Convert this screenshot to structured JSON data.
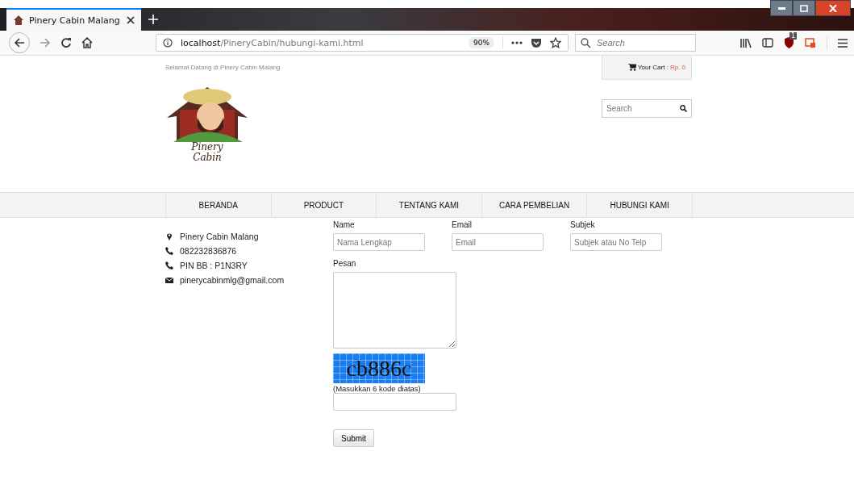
{
  "browser": {
    "tab_title": "Pinery Cabin Malang",
    "url_host": "localhost",
    "url_path": "/PineryCabin/hubungi-kami.html",
    "zoom": "90%",
    "search_placeholder": "Search",
    "badge": "1"
  },
  "header": {
    "welcome": "Selamat Datang di Pinery Cabin Malang",
    "cart_label": "Your Cart :",
    "cart_value": "Rp. 0",
    "search_placeholder": "Search",
    "logo_text": [
      "Pinery",
      "Cabin"
    ]
  },
  "nav": [
    {
      "label": "BERANDA",
      "selected": false
    },
    {
      "label": "PRODUCT",
      "selected": false
    },
    {
      "label": "TENTANG KAMI",
      "selected": false
    },
    {
      "label": "CARA PEMBELIAN",
      "selected": false
    },
    {
      "label": "HUBUNGI KAMI",
      "selected": false
    }
  ],
  "contact": [
    {
      "kind": "location",
      "text": "Pinery Cabin Malang"
    },
    {
      "kind": "phone",
      "text": "082232836876"
    },
    {
      "kind": "phone",
      "text": "PIN BB : P1N3RY"
    },
    {
      "kind": "email",
      "text": "pinerycabinmlg@gmail.com"
    }
  ],
  "form": {
    "fields": [
      {
        "label": "Name",
        "placeholder": "Nama Lengkap"
      },
      {
        "label": "Email",
        "placeholder": "Email"
      },
      {
        "label": "Subjek",
        "placeholder": "Subjek atau No Telp"
      }
    ],
    "message_label": "Pesan",
    "captcha": "cb886c",
    "captcha_hint": "(Masukkan 6 kode diatas)",
    "submit": "Submit"
  }
}
